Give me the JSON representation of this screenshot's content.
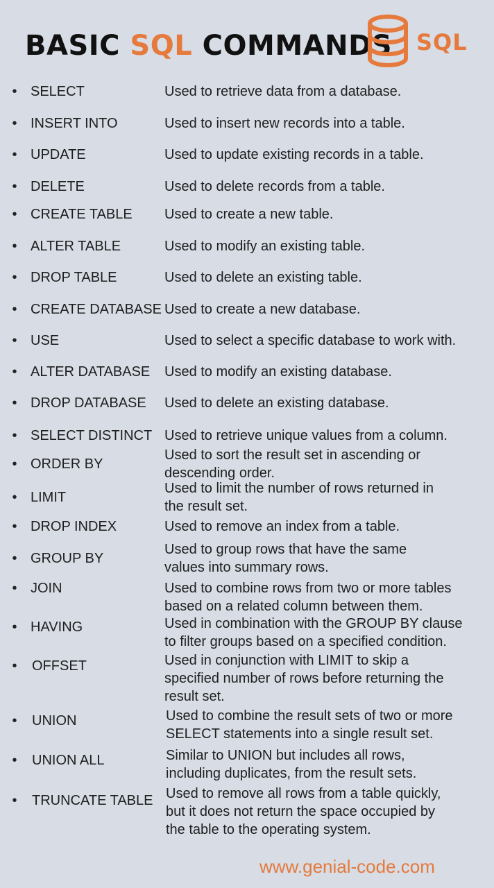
{
  "header": {
    "title_part1": "BASIC ",
    "title_accent": "SQL",
    "title_part2": " COMMANDS",
    "logo_text": "SQL",
    "logo_icon": "database-icon"
  },
  "colors": {
    "accent": "#e57a3c",
    "background": "#d7dce5",
    "text": "#1e1e1e"
  },
  "bullet_symbol": "•",
  "commands": [
    {
      "name": "SELECT",
      "description": "Used to retrieve data from a database."
    },
    {
      "name": "INSERT INTO",
      "description": "Used to insert new records into a table."
    },
    {
      "name": "UPDATE",
      "description": "Used to update existing records in a table."
    },
    {
      "name": "DELETE",
      "description": "Used to delete records from a table."
    },
    {
      "name": "CREATE TABLE",
      "description": "Used to create a new table."
    },
    {
      "name": "ALTER TABLE",
      "description": "Used to modify an existing table."
    },
    {
      "name": "DROP TABLE",
      "description": "Used to delete an existing table."
    },
    {
      "name": "CREATE DATABASE",
      "description": "Used to create a new database."
    },
    {
      "name": "USE",
      "description": "Used to select a specific database to work with."
    },
    {
      "name": "ALTER DATABASE",
      "description": "Used to modify an existing database."
    },
    {
      "name": "DROP DATABASE",
      "description": "Used to delete an existing database."
    },
    {
      "name": "SELECT DISTINCT",
      "description": "Used to retrieve unique values from a column."
    },
    {
      "name": "ORDER BY",
      "description": "Used to sort the result set in ascending or\ndescending order."
    },
    {
      "name": "LIMIT",
      "description": "Used to limit the number of rows returned in\nthe result set."
    },
    {
      "name": "DROP INDEX",
      "description": "Used to remove an index from a table."
    },
    {
      "name": "GROUP BY",
      "description": "Used to group rows that have the same\nvalues into summary rows."
    },
    {
      "name": "JOIN",
      "description": "Used to combine rows from two or more tables\nbased on a related column between them."
    },
    {
      "name": "HAVING",
      "description": "Used in combination with the GROUP BY clause\nto filter groups based on a specified condition."
    },
    {
      "name": "OFFSET",
      "description": "Used in conjunction with LIMIT to skip a\nspecified number of rows before returning the\nresult set."
    },
    {
      "name": "UNION",
      "description": "Used to combine the result sets of two or more\nSELECT statements into a single result set."
    },
    {
      "name": "UNION ALL",
      "description": "Similar to UNION but includes all rows,\nincluding duplicates, from the result sets."
    },
    {
      "name": "TRUNCATE TABLE",
      "description": "Used to remove all rows from a table quickly,\nbut it does not return the space occupied by\nthe table to the operating system."
    }
  ],
  "footer": {
    "website": "www.genial-code.com"
  }
}
